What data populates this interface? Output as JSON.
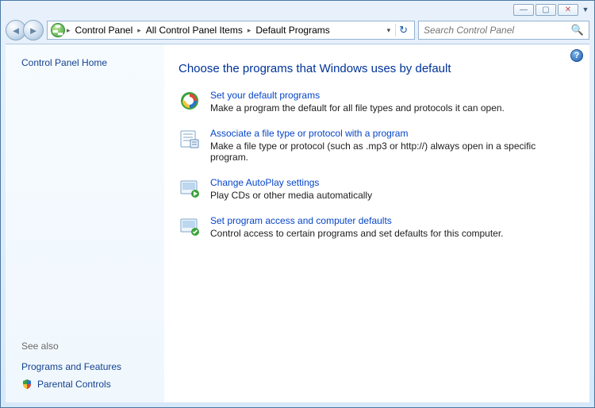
{
  "breadcrumb": {
    "seg1": "Control Panel",
    "seg2": "All Control Panel Items",
    "seg3": "Default Programs"
  },
  "search": {
    "placeholder": "Search Control Panel"
  },
  "sidebar": {
    "home": "Control Panel Home",
    "seealso_label": "See also",
    "link1": "Programs and Features",
    "link2": "Parental Controls"
  },
  "main": {
    "heading": "Choose the programs that Windows uses by default",
    "options": [
      {
        "title": "Set your default programs",
        "desc": "Make a program the default for all file types and protocols it can open."
      },
      {
        "title": "Associate a file type or protocol with a program",
        "desc": "Make a file type or protocol (such as .mp3 or http://) always open in a specific program."
      },
      {
        "title": "Change AutoPlay settings",
        "desc": "Play CDs or other media automatically"
      },
      {
        "title": "Set program access and computer defaults",
        "desc": "Control access to certain programs and set defaults for this computer."
      }
    ]
  }
}
